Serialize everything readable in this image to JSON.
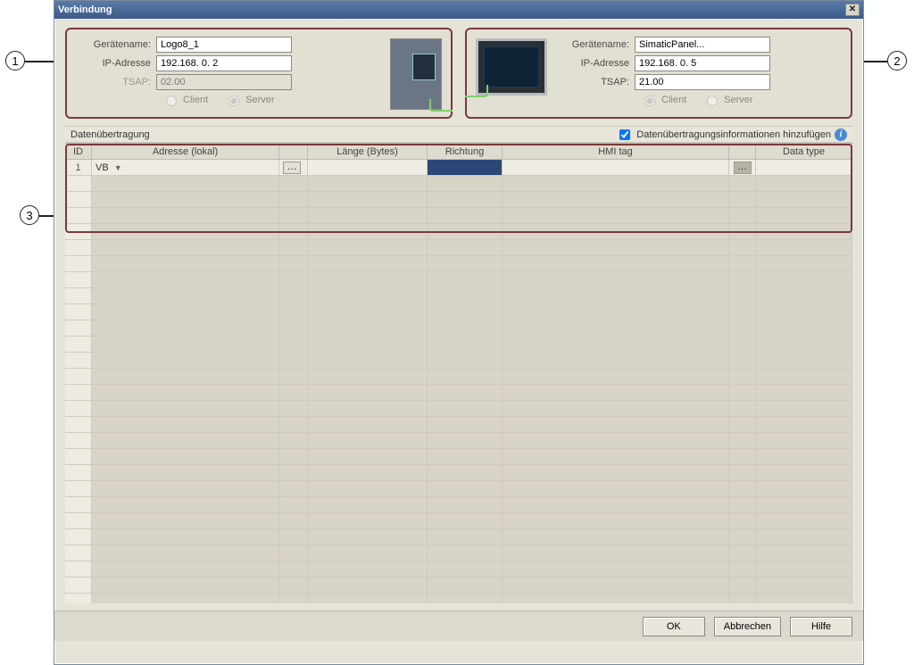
{
  "window": {
    "title": "Verbindung"
  },
  "panel1": {
    "labels": {
      "name": "Gerätename:",
      "ip": "IP-Adresse",
      "tsap": "TSAP:"
    },
    "name": "Logo8_1",
    "ip": "192.168. 0. 2",
    "tsap": "02.00",
    "role": {
      "client": "Client",
      "server": "Server",
      "selected": "server"
    }
  },
  "panel2": {
    "labels": {
      "name": "Gerätename:",
      "ip": "IP-Adresse",
      "tsap": "TSAP:"
    },
    "name": "SimaticPanel...",
    "ip": "192.168. 0. 5",
    "tsap": "21.00",
    "role": {
      "client": "Client",
      "server": "Server",
      "selected": "client"
    }
  },
  "section": {
    "title": "Datenübertragung",
    "addInfoLabel": "Datenübertragungsinformationen hinzufügen",
    "addInfoChecked": true
  },
  "grid": {
    "headers": {
      "id": "ID",
      "addr": "Adresse (lokal)",
      "len": "Länge (Bytes)",
      "dir": "Richtung",
      "hmi": "HMI tag",
      "dtype": "Data type"
    },
    "rows": [
      {
        "id": "1",
        "addr": "VB",
        "len": "",
        "dir": "",
        "hmi": "",
        "dtype": ""
      }
    ],
    "emptyRowCount": 27
  },
  "footer": {
    "ok": "OK",
    "cancel": "Abbrechen",
    "help": "Hilfe"
  },
  "callouts": {
    "c1": "1",
    "c2": "2",
    "c3": "3"
  }
}
